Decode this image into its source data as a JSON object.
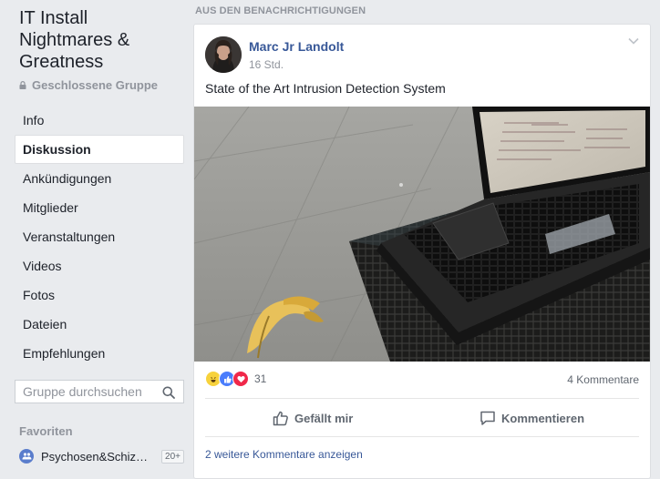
{
  "group": {
    "title": "IT Install Nightmares & Greatness",
    "type": "Geschlossene Gruppe"
  },
  "nav": {
    "items": [
      "Info",
      "Diskussion",
      "Ankündigungen",
      "Mitglieder",
      "Veranstaltungen",
      "Videos",
      "Fotos",
      "Dateien",
      "Empfehlungen"
    ],
    "active": "Diskussion"
  },
  "search": {
    "placeholder": "Gruppe durchsuchen"
  },
  "favorites": {
    "heading": "Favoriten",
    "items": [
      {
        "label": "Psychosen&Schiz…",
        "count": "20+"
      }
    ]
  },
  "feed": {
    "section_label": "AUS DEN BENACHRICHTIGUNGEN"
  },
  "post": {
    "author": "Marc Jr Landolt",
    "timestamp": "16 Std.",
    "text": "State of the Art Intrusion Detection System",
    "reactions": {
      "icons": [
        "haha-icon",
        "like-icon",
        "love-icon"
      ],
      "count": "31"
    },
    "comments_count": "4 Kommentare",
    "actions": {
      "like": "Gefällt mir",
      "comment": "Kommentieren"
    },
    "more_comments": "2 weitere Kommentare anzeigen"
  },
  "colors": {
    "brand_link": "#385898",
    "background": "#e9ebee",
    "like_blue": "#4a7dfc",
    "love_red": "#f0284a",
    "haha_yellow": "#f7d23c"
  }
}
